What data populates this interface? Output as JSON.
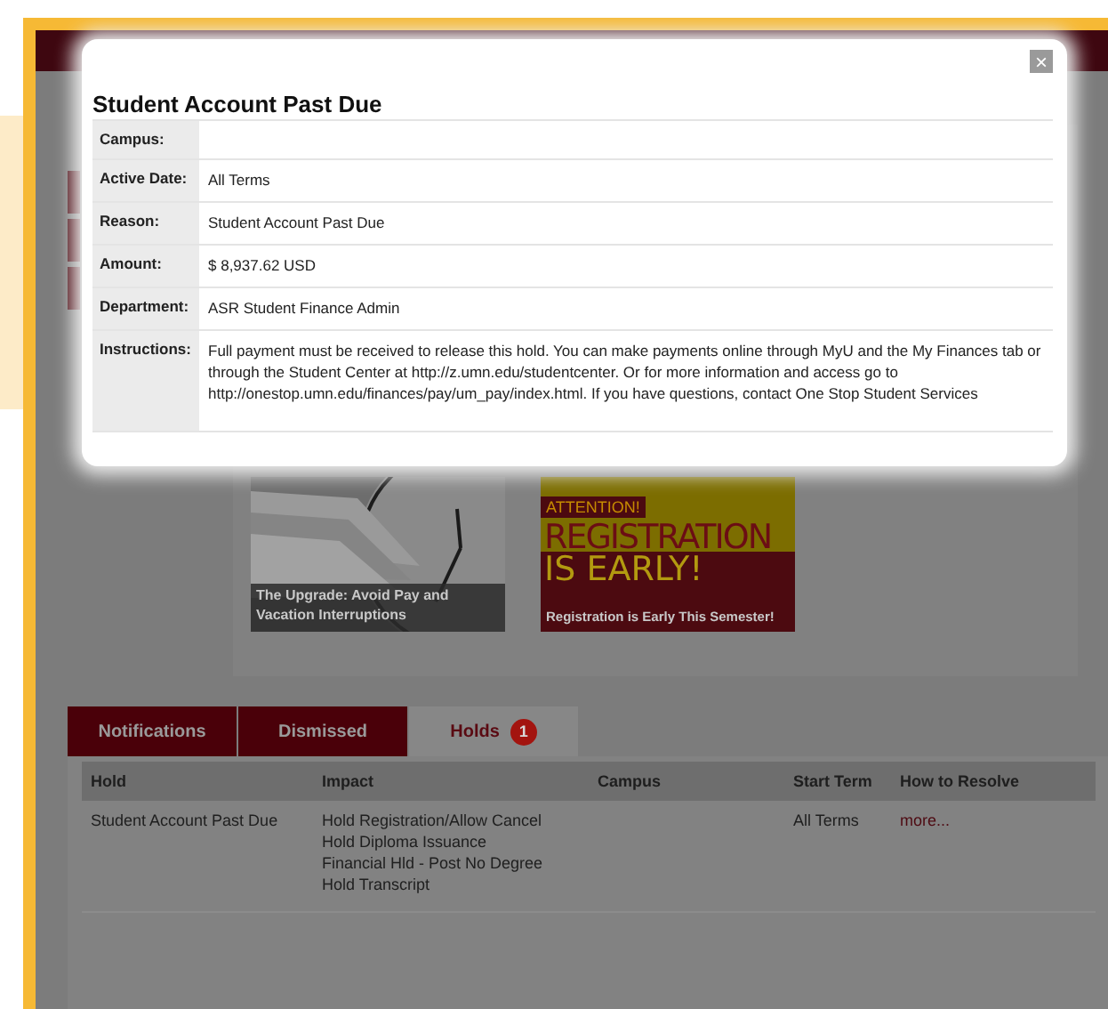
{
  "modal": {
    "title": "Student Account Past Due",
    "close": "×",
    "fields": [
      {
        "label": "Campus:"
      },
      {
        "label": "Active Date:",
        "value": "All Terms"
      },
      {
        "label": "Reason:",
        "value": "Student Account Past Due"
      },
      {
        "label": "Amount:",
        "value": "$ 8,937.62 USD"
      },
      {
        "label": "Department:",
        "value": "ASR Student Finance Admin"
      },
      {
        "label": "Instructions:",
        "value": "Full payment must be received to release this hold. You can make payments online through MyU and the My Finances tab or through the Student Center at http://z.umn.edu/studentcenter. Or for more information and access go to http://onestop.umn.edu/finances/pay/um_pay/index.html. If you have questions, contact One Stop Student Services"
      }
    ]
  },
  "banners": [
    {
      "caption": "The Upgrade: Avoid Pay and Vacation Interruptions"
    },
    {
      "kind": "graphic",
      "tag": "ATTENTION!",
      "headline": [
        "REGISTRATION",
        "IS EARLY!"
      ],
      "caption": "Registration is Early This Semester!"
    }
  ],
  "tabs": [
    {
      "label": "Notifications",
      "selected": false
    },
    {
      "label": "Dismissed",
      "selected": false
    },
    {
      "label": "Holds",
      "selected": true,
      "badge": "1"
    }
  ],
  "table": {
    "columns": [
      "Hold",
      "Impact",
      "Campus",
      "Start Term",
      "How to Resolve"
    ],
    "rows": [
      {
        "hold": "Student Account Past Due",
        "impact": [
          "Hold Registration/Allow Cancel",
          "Hold Diploma Issuance",
          "Financial Hld - Post No Degree",
          "Hold Transcript"
        ],
        "start_term": "All Terms",
        "resolve": "more..."
      }
    ]
  }
}
